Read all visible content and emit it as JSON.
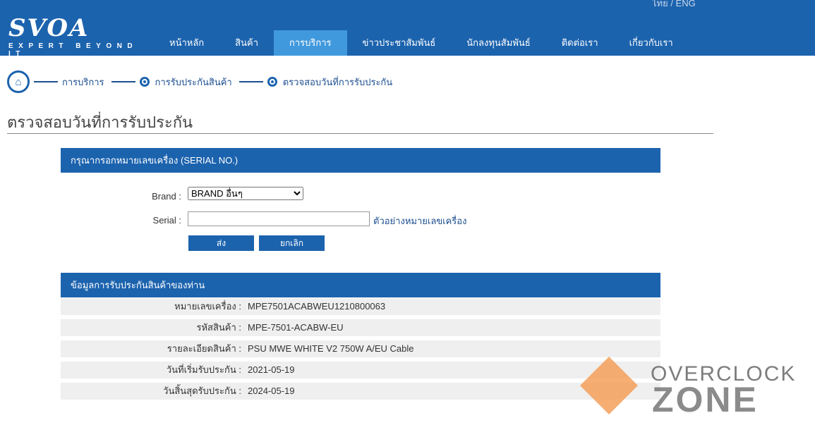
{
  "header": {
    "lang": "ไทย / ENG",
    "logo_text": "SVOA",
    "logo_tagline": "EXPERT BEYOND IT",
    "nav": [
      "หน้าหลัก",
      "สินค้า",
      "การบริการ",
      "ข่าวประชาสัมพันธ์",
      "นักลงทุนสัมพันธ์",
      "ติดต่อเรา",
      "เกี่ยวกับเรา"
    ],
    "active_nav": "การบริการ"
  },
  "breadcrumb": [
    "การบริการ",
    "การรับประกันสินค้า",
    "ตรวจสอบวันที่การรับประกัน"
  ],
  "page_title": "ตรวจสอบวันที่การรับประกัน",
  "form": {
    "header": "กรุณากรอกหมายเลขเครื่อง (SERIAL NO.)",
    "brand_label": "Brand :",
    "brand_value": "BRAND อื่นๆ",
    "serial_label": "Serial :",
    "serial_value": "",
    "example_link": "ตัวอย่างหมายเลขเครื่อง",
    "submit": "ส่ง",
    "cancel": "ยกเลิก"
  },
  "result": {
    "header": "ข้อมูลการรับประกันสินค้าของท่าน",
    "rows": [
      {
        "label": "หมายเลขเครื่อง :",
        "value": "MPE7501ACABWEU1210800063"
      },
      {
        "label": "รหัสสินค้า :",
        "value": "MPE-7501-ACABW-EU"
      },
      {
        "label": "รายละเอียดสินค้า :",
        "value": "PSU MWE WHITE V2 750W A/EU Cable"
      },
      {
        "label": "วันที่เริ่มรับประกัน :",
        "value": "2021-05-19"
      },
      {
        "label": "วันสิ้นสุดรับประกัน :",
        "value": "2024-05-19"
      }
    ]
  },
  "watermark": {
    "line1": "OVERCLOCK",
    "line2": "ZONE"
  },
  "colors": {
    "primary": "#1c63ae",
    "active": "#4199dd"
  }
}
